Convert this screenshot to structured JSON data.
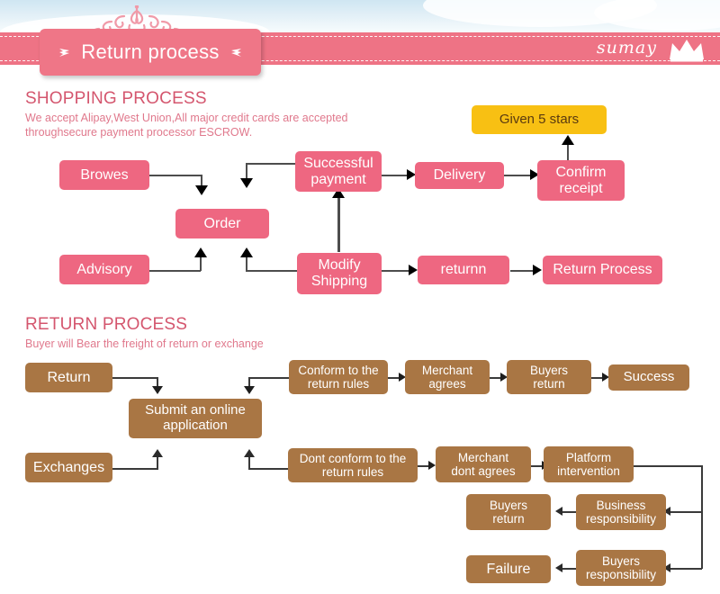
{
  "header": {
    "title": "Return process",
    "brand": "sumay",
    "left_icon": "crown-icon",
    "right_icon": "crown-icon",
    "brand_icon": "crown-icon",
    "ornament_icon": "tiara-ornament-icon",
    "band_color": "#ee7385",
    "plaque_color": "#ef7687"
  },
  "shopping": {
    "heading": "SHOPPING PROCESS",
    "subtext_line1": "We accept Alipay,West Union,All major credit cards are accepted",
    "subtext_line2": "throughsecure payment processor ESCROW.",
    "box_color": "#ee6781",
    "highlight_color": "#f8c013",
    "boxes": [
      {
        "id": "browes",
        "label": "Browes"
      },
      {
        "id": "order",
        "label": "Order"
      },
      {
        "id": "advisory",
        "label": "Advisory"
      },
      {
        "id": "successful-payment",
        "label": "Successful\npayment",
        "line1": "Successful",
        "line2": "payment"
      },
      {
        "id": "modify-shipping",
        "label": "Modify\nShipping",
        "line1": "Modify",
        "line2": "Shipping"
      },
      {
        "id": "delivery",
        "label": "Delivery"
      },
      {
        "id": "confirm-receipt",
        "label": "Confirm\nreceipt",
        "line1": "Confirm",
        "line2": "receipt"
      },
      {
        "id": "given-5-stars",
        "label": "Given 5 stars"
      },
      {
        "id": "returnn",
        "label": "returnn"
      },
      {
        "id": "return-process",
        "label": "Return Process"
      }
    ]
  },
  "returns": {
    "heading": "RETURN PROCESS",
    "subtext": "Buyer will Bear the freight of return or exchange",
    "box_color": "#a97644",
    "boxes": [
      {
        "id": "return",
        "label": "Return"
      },
      {
        "id": "exchanges",
        "label": "Exchanges"
      },
      {
        "id": "submit-online-application",
        "label": "Submit an online application",
        "line1": "Submit an online",
        "line2": "application"
      },
      {
        "id": "conform-to-return-rules",
        "label": "Conform to the return rules",
        "line1": "Conform to the",
        "line2": "return rules"
      },
      {
        "id": "merchant-agrees",
        "label": "Merchant agrees",
        "line1": "Merchant",
        "line2": "agrees"
      },
      {
        "id": "buyers-return-top",
        "label": "Buyers return",
        "line1": "Buyers",
        "line2": "return"
      },
      {
        "id": "success",
        "label": "Success"
      },
      {
        "id": "dont-conform-to-return-rules",
        "label": "Dont conform to the return rules",
        "line1": "Dont conform to the",
        "line2": "return rules"
      },
      {
        "id": "merchant-dont-agrees",
        "label": "Merchant dont agrees",
        "line1": "Merchant",
        "line2": "dont agrees"
      },
      {
        "id": "platform-intervention",
        "label": "Platform intervention",
        "line1": "Platform",
        "line2": "intervention"
      },
      {
        "id": "business-responsibility",
        "label": "Business responsibility",
        "line1": "Business",
        "line2": "responsibility"
      },
      {
        "id": "buyers-return-mid",
        "label": "Buyers return",
        "line1": "Buyers",
        "line2": "return"
      },
      {
        "id": "buyers-responsibility",
        "label": "Buyers responsibility",
        "line1": "Buyers",
        "line2": "responsibility"
      },
      {
        "id": "failure",
        "label": "Failure"
      }
    ]
  }
}
